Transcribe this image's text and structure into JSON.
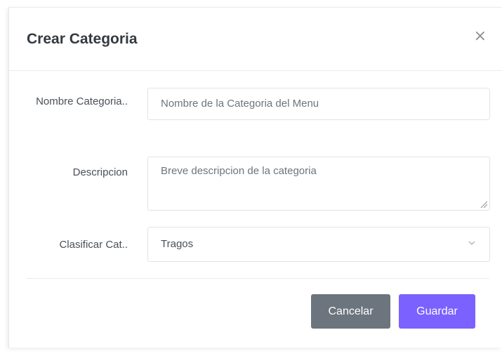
{
  "modal": {
    "title": "Crear Categoria",
    "close_symbol": "×"
  },
  "form": {
    "nombre": {
      "label": "Nombre Categoria..",
      "placeholder": "Nombre de la Categoria del Menu",
      "value": ""
    },
    "descripcion": {
      "label": "Descripcion",
      "placeholder": "Breve descripcion de la categoria",
      "value": ""
    },
    "clasificar": {
      "label": "Clasificar Cat..",
      "selected": "Tragos",
      "icon": "chevron-down-icon"
    }
  },
  "buttons": {
    "cancel_label": "Cancelar",
    "save_label": "Guardar"
  },
  "colors": {
    "cancel_bg": "#6c757d",
    "save_bg": "#7b61ff"
  }
}
